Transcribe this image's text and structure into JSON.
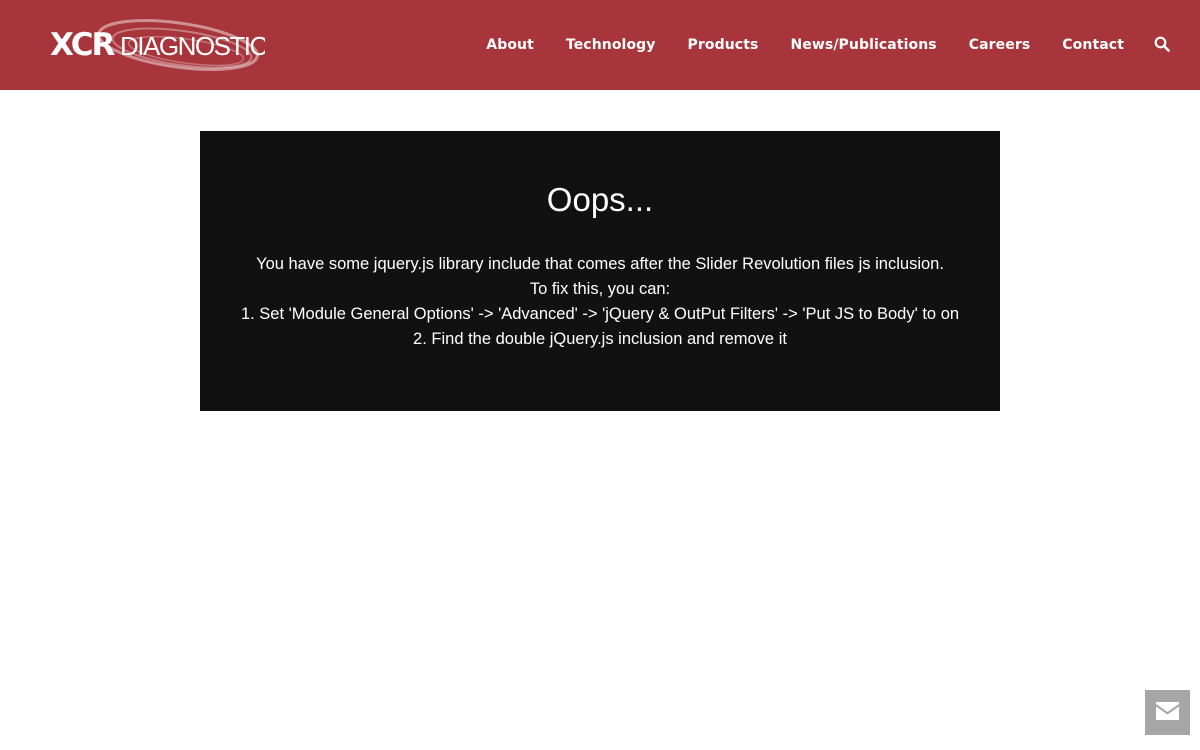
{
  "header": {
    "logo": {
      "brand_bold": "XCR",
      "brand_light": "DIAGNOSTICS"
    },
    "nav": [
      {
        "label": "About"
      },
      {
        "label": "Technology"
      },
      {
        "label": "Products"
      },
      {
        "label": "News/Publications"
      },
      {
        "label": "Careers"
      },
      {
        "label": "Contact"
      }
    ],
    "search_icon": "search-icon"
  },
  "error": {
    "title": "Oops...",
    "lines": [
      "You have some jquery.js library include that comes after the Slider Revolution files js inclusion.",
      "To fix this, you can:",
      "1. Set 'Module General Options' -> 'Advanced' -> 'jQuery & OutPut Filters' -> 'Put JS to Body' to on",
      "2. Find the double jQuery.js inclusion and remove it"
    ]
  },
  "contact_widget": {
    "icon": "envelope-icon"
  },
  "colors": {
    "header_bg": "#a8353c",
    "error_bg": "#111111",
    "widget_bg": "#a6a6a6"
  }
}
